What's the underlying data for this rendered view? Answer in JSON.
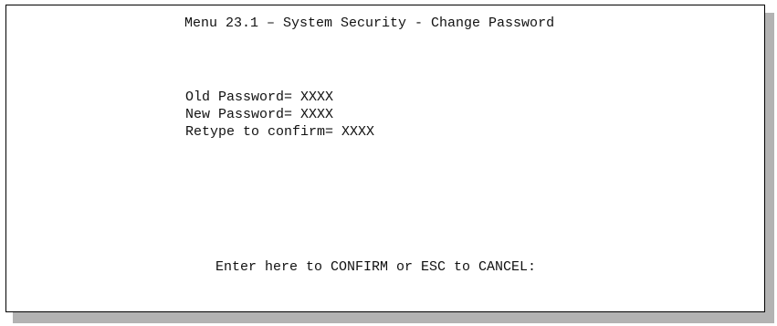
{
  "menu": {
    "title": "Menu 23.1 – System Security - Change Password"
  },
  "fields": [
    {
      "label": "Old Password= ",
      "value": "XXXX"
    },
    {
      "label": "New Password= ",
      "value": "XXXX"
    },
    {
      "label": "Retype to confirm= ",
      "value": "XXXX"
    }
  ],
  "footer": {
    "prompt": "Enter here to CONFIRM or ESC to CANCEL:"
  }
}
